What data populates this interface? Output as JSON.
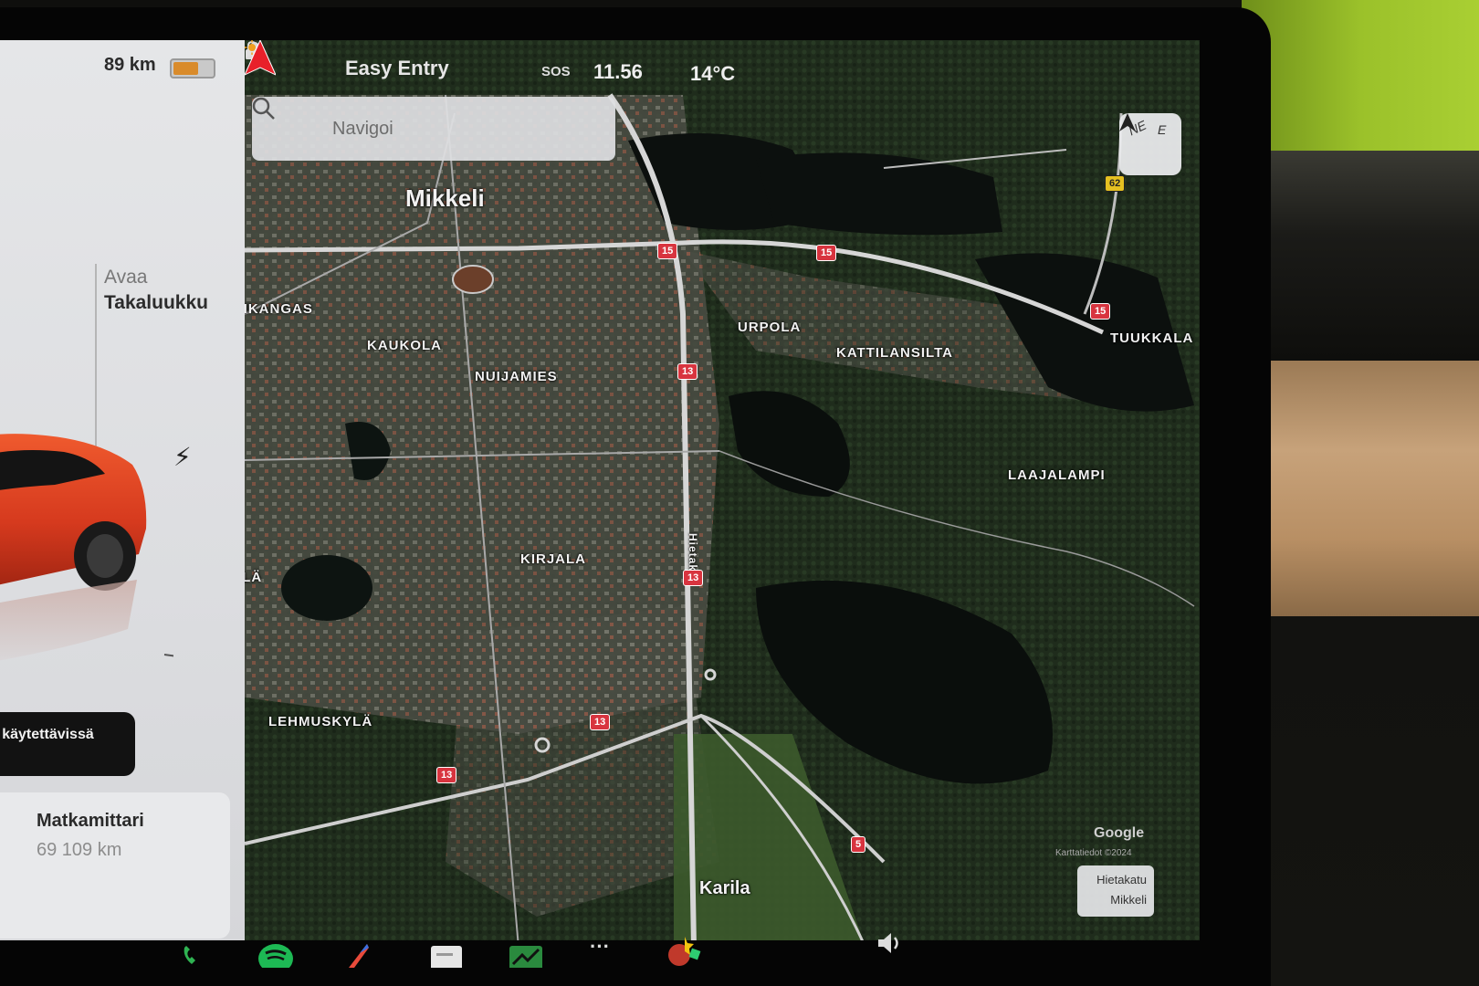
{
  "vehicle": {
    "range": "89 km",
    "battery_percent": 0.65,
    "trunk_action": "Avaa",
    "trunk_label": "Takaluukku",
    "charge_status": "llä käytettävissä",
    "odometer_title": "Matkamittari",
    "odometer_value": "69 109 km"
  },
  "status_bar": {
    "profile": "Easy Entry",
    "sos": "SOS",
    "time": "11.56",
    "temperature": "14°C"
  },
  "search": {
    "placeholder": "Navigoi"
  },
  "compass": {
    "ne": "NE",
    "e": "E"
  },
  "map": {
    "city": "Mikkeli",
    "districts": [
      "NKANGAS",
      "KAUKOLA",
      "NUIJAMIES",
      "URPOLA",
      "KATTILANSILTA",
      "TUUKKALA",
      "LAAJALAMPI",
      "KIRJALA",
      "LEHMUSKYLÄ",
      "ILÄ"
    ],
    "place": "Karila",
    "street_vertical": "Hietak",
    "road_numbers": [
      "15",
      "15",
      "15",
      "13",
      "13",
      "13",
      "13",
      "5",
      "62"
    ],
    "google": "Google",
    "attribution": "Karttatiedot ©2024",
    "current_street": "Hietakatu",
    "current_city": "Mikkeli"
  },
  "colors": {
    "car_red": "#d63a1e",
    "shield_red": "#d8343f",
    "nav_arrow": "#e8202a"
  },
  "dock": {
    "icons": [
      "phone-icon",
      "spotify-icon",
      "toybox-icon",
      "calendar-icon",
      "stocks-icon",
      "more-icon",
      "games-icon",
      "volume-icon"
    ]
  }
}
